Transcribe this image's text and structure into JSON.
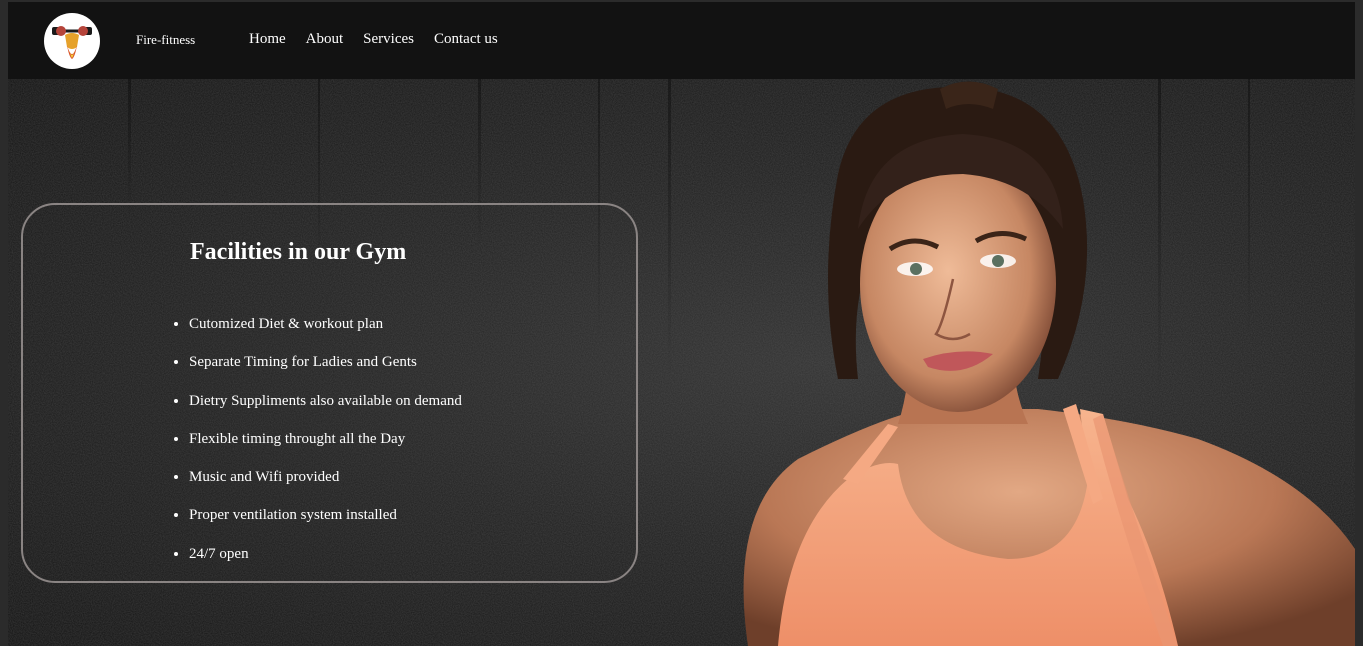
{
  "header": {
    "brand": "Fire-fitness",
    "logo_icon": "flexing-muscle-logo-icon",
    "nav": [
      {
        "label": "Home"
      },
      {
        "label": "About"
      },
      {
        "label": "Services"
      },
      {
        "label": "Contact us"
      }
    ]
  },
  "facilities": {
    "title": "Facilities in our Gym",
    "items": [
      "Cutomized Diet & workout plan",
      "Separate Timing for Ladies and Gents",
      "Dietry Suppliments also available on demand",
      "Flexible timing throught all the Day",
      "Music and Wifi provided",
      "Proper ventilation system installed",
      "24/7 open"
    ]
  },
  "hero": {
    "image": "woman-in-peach-sports-bra-photo"
  },
  "colors": {
    "nav_bg": "#121212",
    "card_border": "#8a8483",
    "text": "#ffffff",
    "sports_bra": "#f4a07a",
    "skin": "#c98e6c"
  }
}
